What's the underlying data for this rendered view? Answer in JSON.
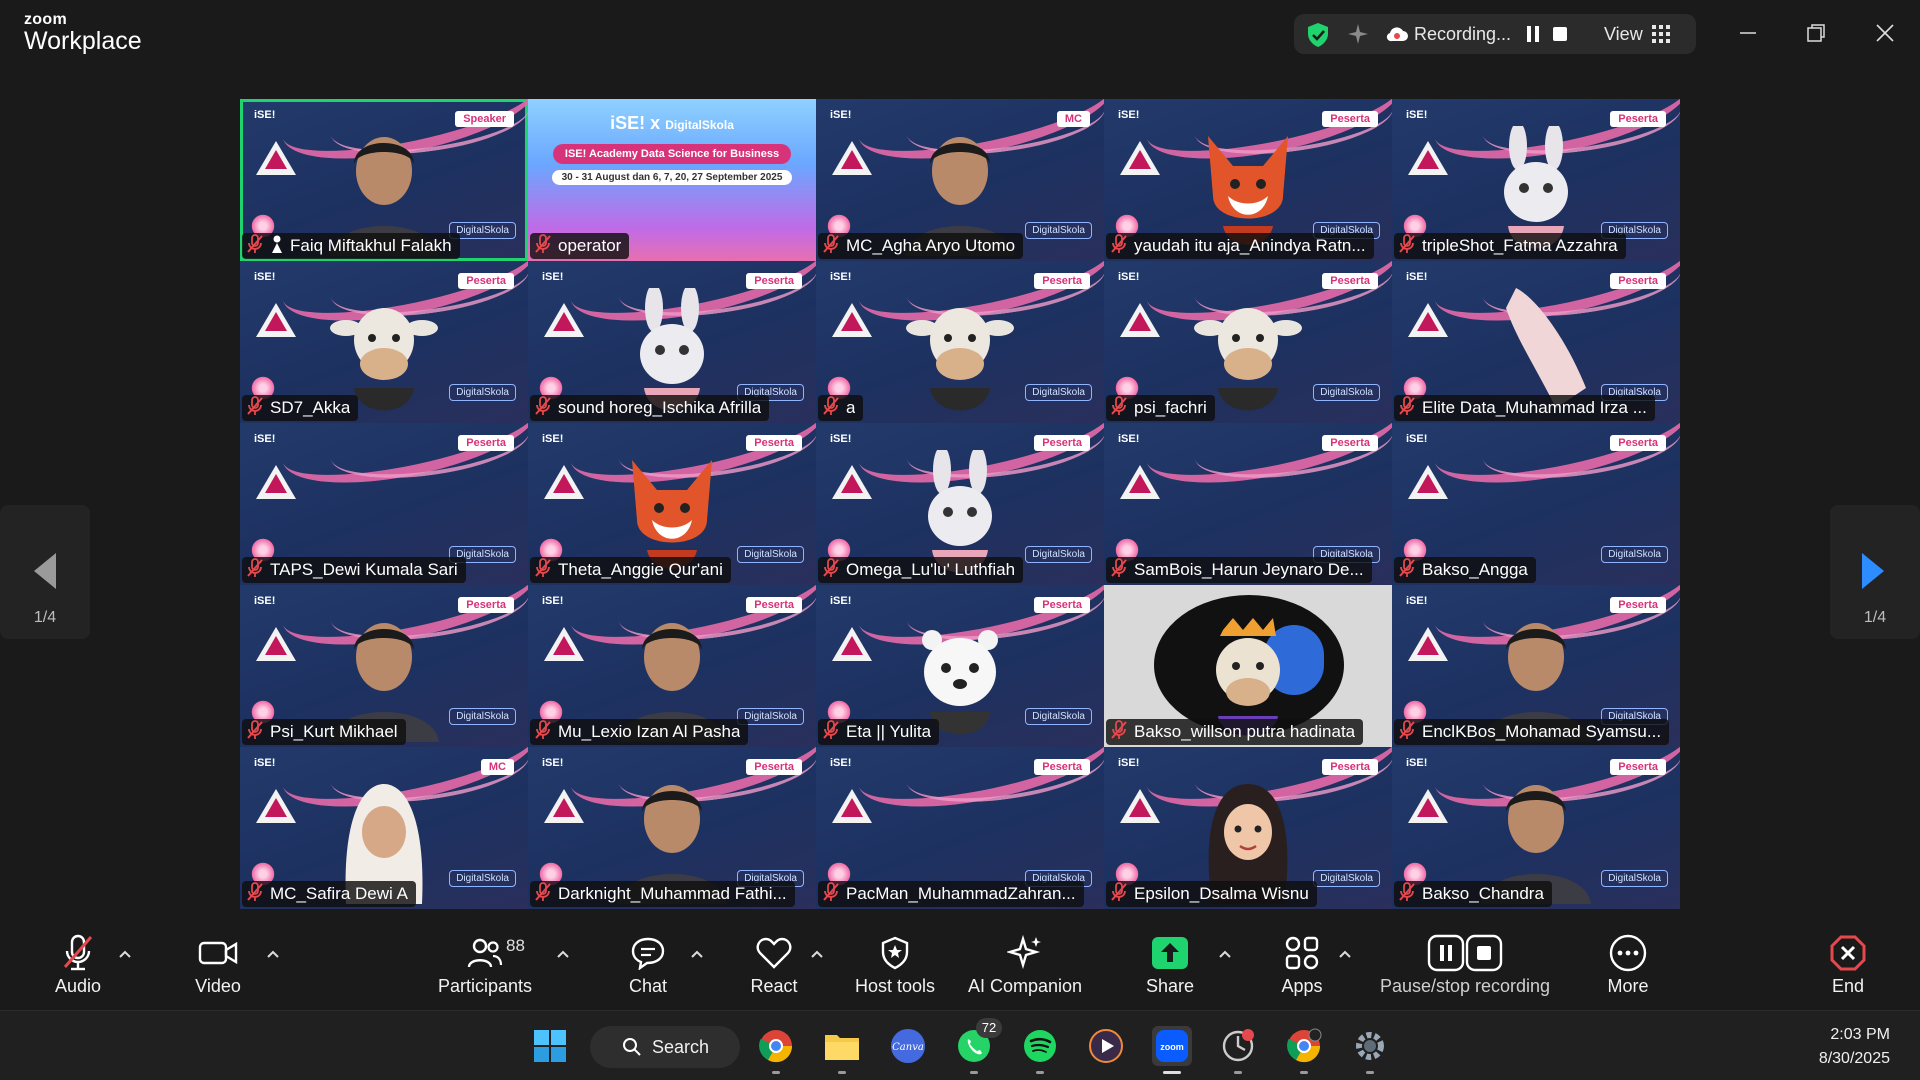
{
  "app": {
    "logo_top": "zoom",
    "logo_bottom": "Workplace"
  },
  "topbar": {
    "recording_label": "Recording...",
    "view_label": "View",
    "icons": [
      "security-shield-icon",
      "sparkle-icon",
      "cloud-record-icon",
      "pause-icon",
      "stop-icon",
      "grid-view-icon",
      "minimize-icon",
      "restore-icon",
      "close-icon"
    ],
    "colors": {
      "shield": "#1fd36f"
    }
  },
  "pagination": {
    "left_page": "1/4",
    "right_page": "1/4",
    "colors": {
      "next_arrow": "#2d8cff",
      "prev_arrow": "#9a9a9a"
    }
  },
  "operator_slide": {
    "brand_left": "iSE!",
    "brand_x": "x",
    "brand_right": "DigitalSkola",
    "title": "ISE! Academy Data Science for Business",
    "dates": "30 - 31 August dan 6, 7, 20, 27 September 2025"
  },
  "tiles": [
    {
      "name": "Faiq Miftakhul Falakh",
      "badge": "Speaker",
      "active": true,
      "kind": "person"
    },
    {
      "name": "operator",
      "badge": "",
      "kind": "slide"
    },
    {
      "name": "MC_Agha Aryo Utomo",
      "badge": "MC",
      "kind": "person"
    },
    {
      "name": "yaudah itu aja_Anindya Ratn...",
      "badge": "Peserta",
      "kind": "fox"
    },
    {
      "name": "tripleShot_Fatma Azzahra",
      "badge": "Peserta",
      "kind": "bunny"
    },
    {
      "name": "SD7_Akka",
      "badge": "Peserta",
      "kind": "cow"
    },
    {
      "name": "sound horeg_Ischika Afrilla",
      "badge": "Peserta",
      "kind": "bunny"
    },
    {
      "name": "a",
      "badge": "Peserta",
      "kind": "cow"
    },
    {
      "name": "psi_fachri",
      "badge": "Peserta",
      "kind": "cow"
    },
    {
      "name": "Elite Data_Muhammad Irza ...",
      "badge": "Peserta",
      "kind": "hand"
    },
    {
      "name": "TAPS_Dewi Kumala Sari",
      "badge": "Peserta",
      "kind": "empty"
    },
    {
      "name": "Theta_Anggie Qur'ani",
      "badge": "Peserta",
      "kind": "fox"
    },
    {
      "name": "Omega_Lu'lu' Luthfiah",
      "badge": "Peserta",
      "kind": "bunny"
    },
    {
      "name": "SamBois_Harun Jeynaro De...",
      "badge": "Peserta",
      "kind": "empty"
    },
    {
      "name": "Bakso_Angga",
      "badge": "Peserta",
      "kind": "empty"
    },
    {
      "name": "Psi_Kurt Mikhael",
      "badge": "Peserta",
      "kind": "person"
    },
    {
      "name": "Mu_Lexio Izan Al Pasha",
      "badge": "Peserta",
      "kind": "person"
    },
    {
      "name": "Eta || Yulita",
      "badge": "Peserta",
      "kind": "bear"
    },
    {
      "name": "Bakso_willson putra hadinata",
      "badge": "",
      "kind": "cow-avatar"
    },
    {
      "name": "EnclKBos_Mohamad Syamsu...",
      "badge": "Peserta",
      "kind": "person"
    },
    {
      "name": "MC_Safira Dewi A",
      "badge": "MC",
      "kind": "person-hijab"
    },
    {
      "name": "Darknight_Muhammad Fathi...",
      "badge": "Peserta",
      "kind": "person"
    },
    {
      "name": "PacMan_MuhammadZahran...",
      "badge": "Peserta",
      "kind": "empty"
    },
    {
      "name": "Epsilon_Dsalma Wisnu",
      "badge": "Peserta",
      "kind": "girl-avatar"
    },
    {
      "name": "Bakso_Chandra",
      "badge": "Peserta",
      "kind": "person"
    }
  ],
  "tile_decor": {
    "ise_mini": "iSE!",
    "ds_mini": "DigitalSkola"
  },
  "toolbar": {
    "audio": "Audio",
    "video": "Video",
    "participants": "Participants",
    "participants_count": "88",
    "chat": "Chat",
    "react": "React",
    "host_tools": "Host tools",
    "ai_companion": "AI Companion",
    "share": "Share",
    "apps": "Apps",
    "pause_stop": "Pause/stop recording",
    "more": "More",
    "end": "End",
    "colors": {
      "share": "#1fd36f",
      "end": "#e5484d",
      "muted": "#e5484d"
    }
  },
  "taskbar": {
    "search_label": "Search",
    "whatsapp_badge": "72",
    "time": "2:03 PM",
    "date": "8/30/2025",
    "icons": [
      "windows-start-icon",
      "search-icon",
      "chrome-icon",
      "file-explorer-icon",
      "canva-icon",
      "whatsapp-icon",
      "spotify-icon",
      "media-player-icon",
      "zoom-icon",
      "app-icon",
      "chrome-profile-icon",
      "settings-icon"
    ]
  }
}
